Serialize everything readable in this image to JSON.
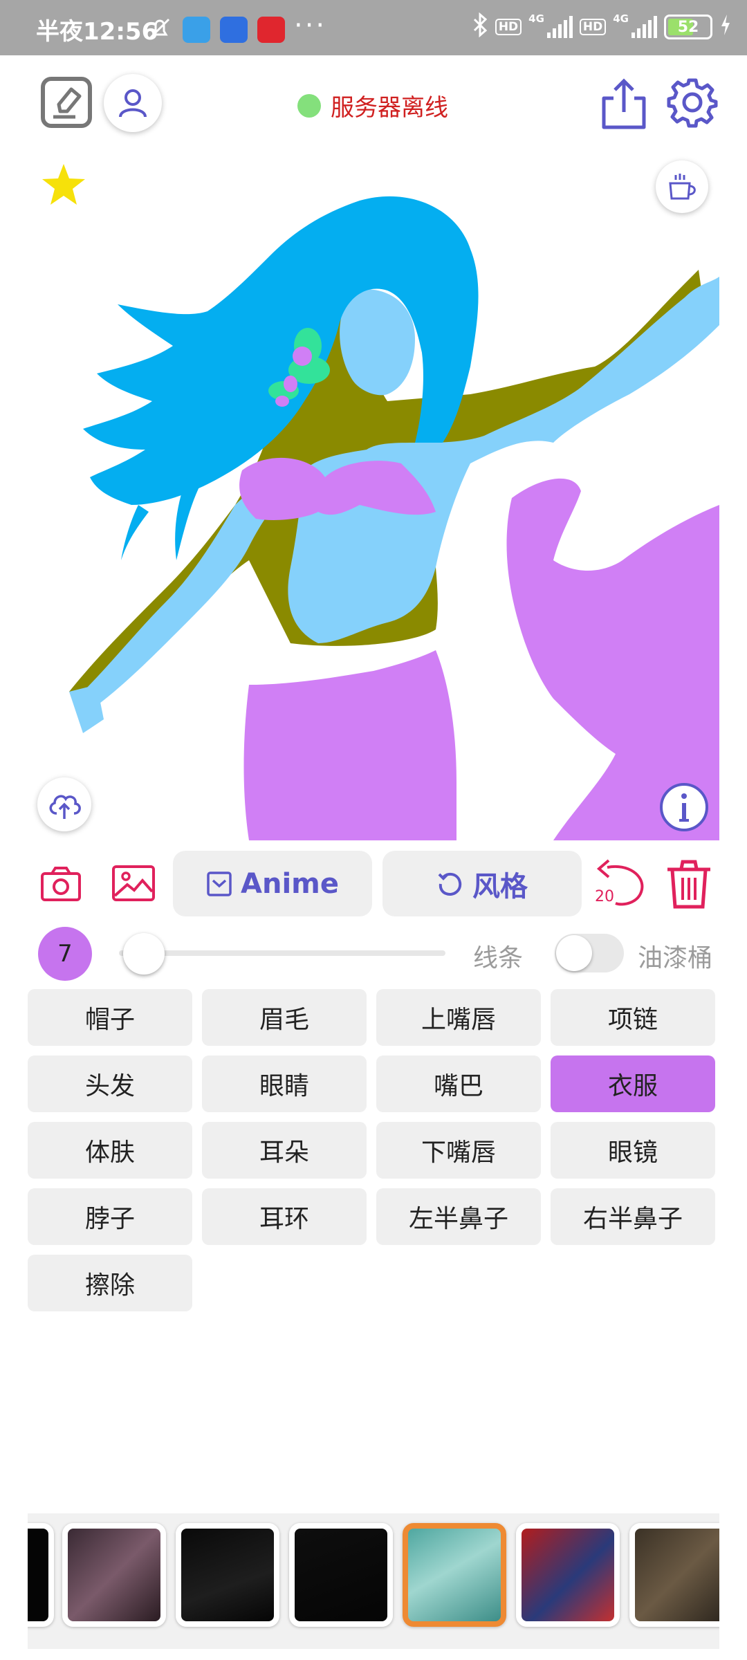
{
  "status_bar": {
    "time": "半夜12:56",
    "more": "···",
    "hd1": "HD",
    "net1": "4G",
    "hd2": "HD",
    "net2": "4G",
    "battery": "52"
  },
  "toolbar": {
    "server_status": "服务器离线",
    "server_color": "#84e07c"
  },
  "actions": {
    "model_label": "Anime",
    "style_label": "风格",
    "undo_count": "20"
  },
  "brush": {
    "size": "7",
    "level": 0.02
  },
  "mode": {
    "line_label": "线条",
    "bucket_label": "油漆桶",
    "bucket_on": false
  },
  "parts": [
    {
      "label": "帽子",
      "active": false
    },
    {
      "label": "眉毛",
      "active": false
    },
    {
      "label": "上嘴唇",
      "active": false
    },
    {
      "label": "项链",
      "active": false
    },
    {
      "label": "头发",
      "active": false
    },
    {
      "label": "眼睛",
      "active": false
    },
    {
      "label": "嘴巴",
      "active": false
    },
    {
      "label": "衣服",
      "active": true
    },
    {
      "label": "体肤",
      "active": false
    },
    {
      "label": "耳朵",
      "active": false
    },
    {
      "label": "下嘴唇",
      "active": false
    },
    {
      "label": "眼镜",
      "active": false
    },
    {
      "label": "脖子",
      "active": false
    },
    {
      "label": "耳环",
      "active": false
    },
    {
      "label": "左半鼻子",
      "active": false
    },
    {
      "label": "右半鼻子",
      "active": false
    },
    {
      "label": "擦除",
      "active": false
    }
  ],
  "colors": {
    "accent": "#5a57c8",
    "danger": "#e0215c",
    "selected_part": "#c674ee",
    "hair": "#04aef0",
    "skin": "#85d1fb",
    "shadow": "#8a8a00",
    "clothes": "#d07ff5"
  }
}
